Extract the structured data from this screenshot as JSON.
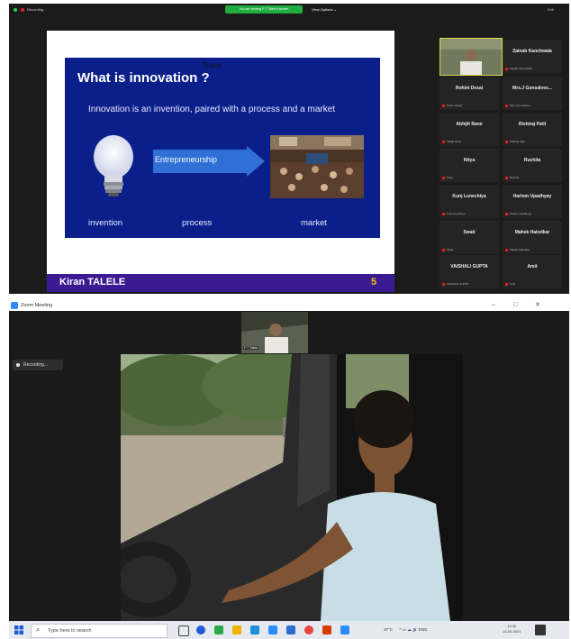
{
  "top_window": {
    "recording_label": "Recording...",
    "share_banner": "You are viewing F T Talele's screen",
    "view_options": "View Options ⌄",
    "exit_label": "Exit",
    "slide": {
      "title": "What is innovation ?",
      "sticker": "Thank",
      "definition": "Innovation is an invention, paired with a process and a market",
      "arrow_label": "Entrepreneurship",
      "captions": [
        "invention",
        "process",
        "market"
      ],
      "author": "Kiran TALELE",
      "page_number": "5"
    },
    "participants": [
      {
        "name": "Zainab Kanchwala",
        "sub": "Zainab Kanchwala"
      },
      {
        "name": "Rohini Desai",
        "sub": "Rohini Desai"
      },
      {
        "name": "Mrs.J Gonsalves...",
        "sub": "Mrs.J Gonsalves"
      },
      {
        "name": "Abhijit Rane",
        "sub": "Abhijit Rane"
      },
      {
        "name": "Rishiraj Patil",
        "sub": "Rishiraj Patil"
      },
      {
        "name": "Nitya",
        "sub": "Nitya"
      },
      {
        "name": "Ruchita",
        "sub": "Ruchita"
      },
      {
        "name": "Kunj Lunechiya",
        "sub": "Kunj Lunechiya"
      },
      {
        "name": "Harlom Upadhyay",
        "sub": "Harlom Upadhyay"
      },
      {
        "name": "Swati",
        "sub": "Swati"
      },
      {
        "name": "Mahek Hatodkar",
        "sub": "Mahek Hatodkar"
      },
      {
        "name": "VAISHALI GUPTA",
        "sub": "VAISHALI GUPTA"
      },
      {
        "name": "Amit",
        "sub": "Amit"
      }
    ]
  },
  "bottom_window": {
    "app_title": "Zoom Meeting",
    "minimize": "–",
    "maximize": "□",
    "close": "✕",
    "pip_label": "F T Talele",
    "recording_label": "Recording..."
  },
  "taskbar": {
    "search_placeholder": "Type here to search",
    "weather": "37°C",
    "tray": "^ ▭ ☁ 🔊 ENG",
    "time": "14:40",
    "date": "13-05-2021",
    "icon_colors": [
      "#1e5bd6",
      "#2aa84a",
      "#f0b400",
      "#1e90d6",
      "#2d8cff",
      "#2b6ed1",
      "#e8453c",
      "#d83b01",
      "#2d8cff"
    ]
  }
}
